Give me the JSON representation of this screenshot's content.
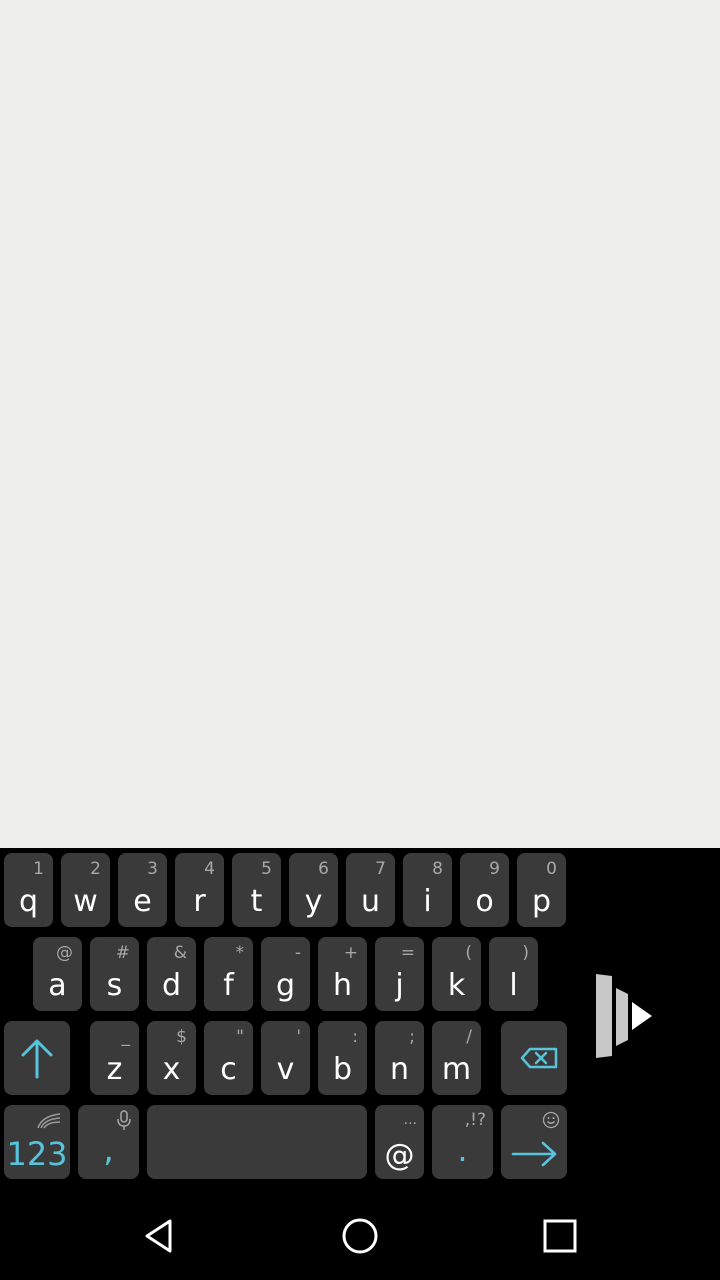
{
  "keyboard": {
    "row1": [
      {
        "id": "q",
        "label": "q",
        "alt": "1"
      },
      {
        "id": "w",
        "label": "w",
        "alt": "2"
      },
      {
        "id": "e",
        "label": "e",
        "alt": "3"
      },
      {
        "id": "r",
        "label": "r",
        "alt": "4"
      },
      {
        "id": "t",
        "label": "t",
        "alt": "5"
      },
      {
        "id": "y",
        "label": "y",
        "alt": "6"
      },
      {
        "id": "u",
        "label": "u",
        "alt": "7"
      },
      {
        "id": "i",
        "label": "i",
        "alt": "8"
      },
      {
        "id": "o",
        "label": "o",
        "alt": "9"
      },
      {
        "id": "p",
        "label": "p",
        "alt": "0"
      }
    ],
    "row2": [
      {
        "id": "a",
        "label": "a",
        "alt": "@"
      },
      {
        "id": "s",
        "label": "s",
        "alt": "#"
      },
      {
        "id": "d",
        "label": "d",
        "alt": "&"
      },
      {
        "id": "f",
        "label": "f",
        "alt": "*"
      },
      {
        "id": "g",
        "label": "g",
        "alt": "-"
      },
      {
        "id": "h",
        "label": "h",
        "alt": "+"
      },
      {
        "id": "j",
        "label": "j",
        "alt": "="
      },
      {
        "id": "k",
        "label": "k",
        "alt": "("
      },
      {
        "id": "l",
        "label": "l",
        "alt": ")"
      }
    ],
    "row3": [
      {
        "id": "z",
        "label": "z",
        "alt": "_"
      },
      {
        "id": "x",
        "label": "x",
        "alt": "$"
      },
      {
        "id": "c",
        "label": "c",
        "alt": "\""
      },
      {
        "id": "v",
        "label": "v",
        "alt": "'"
      },
      {
        "id": "b",
        "label": "b",
        "alt": ":"
      },
      {
        "id": "n",
        "label": "n",
        "alt": ";"
      },
      {
        "id": "m",
        "label": "m",
        "alt": "/"
      }
    ],
    "numbers_key": "123",
    "comma_key": ",",
    "at_key": "@",
    "at_key_alt": "...",
    "period_key": ".",
    "period_key_alt": ",!?",
    "accent_color": "#58c4dc",
    "key_color": "#3a3a3a"
  },
  "icons": {
    "shift": "shift-arrow-icon",
    "backspace": "backspace-icon",
    "enter": "enter-arrow-icon",
    "mic": "mic-icon",
    "emoji": "emoji-icon",
    "swype": "swype-logo-icon",
    "collapse": "keyboard-collapse-icon",
    "back": "back-triangle-icon",
    "home": "home-circle-icon",
    "recents": "recents-square-icon"
  }
}
